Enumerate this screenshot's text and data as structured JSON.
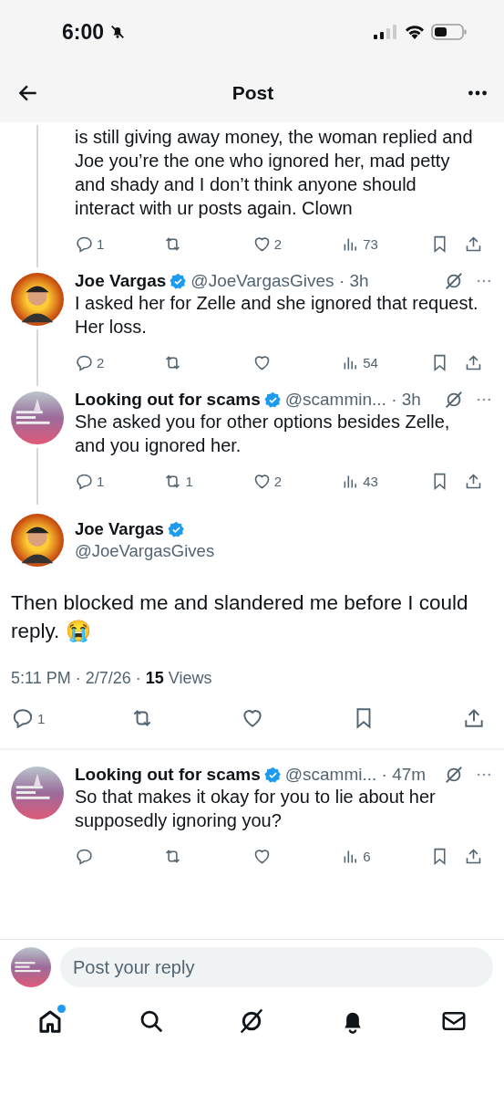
{
  "status_bar": {
    "time": "6:00",
    "silenced": true
  },
  "header": {
    "title": "Post"
  },
  "replies_above": [
    {
      "text": "is still giving away money, the woman replied and Joe you’re the one who ignored her, mad petty and shady and I don’t think anyone should interact with ur posts again. Clown",
      "stats": {
        "replies": "1",
        "likes": "2",
        "views": "73"
      },
      "connected": true
    },
    {
      "author": {
        "name": "Joe Vargas",
        "handle": "@JoeVargasGives",
        "verified": true
      },
      "time": "· 3h",
      "text": "I asked her for Zelle and she ignored that request. Her loss.",
      "stats": {
        "replies": "2",
        "views": "54"
      },
      "connected": true
    },
    {
      "author": {
        "name": "Looking out for scams",
        "handle": "@scammin...",
        "verified": true
      },
      "time": "· 3h",
      "text": "She asked you for other options besides Zelle, and you ignored her.",
      "stats": {
        "replies": "1",
        "reposts": "1",
        "likes": "2",
        "views": "43"
      },
      "connected": true
    }
  ],
  "main_post": {
    "author": {
      "name": "Joe Vargas",
      "handle": "@JoeVargasGives",
      "verified": true
    },
    "text": "Then blocked me and slandered me before I could reply. 😭",
    "timestamp": "5:11 PM · 2/7/26 ·",
    "views_count": "15",
    "views_label": "Views",
    "stats": {
      "replies": "1"
    }
  },
  "replies_below": [
    {
      "author": {
        "name": "Looking out for scams",
        "handle": "@scammi...",
        "verified": true
      },
      "time": "· 47m",
      "text": "So that makes it okay for you to lie about her supposedly ignoring you?",
      "stats": {
        "views": "6"
      },
      "connected": false
    }
  ],
  "composer": {
    "placeholder": "Post your reply"
  },
  "nav": [
    {
      "kind": "home",
      "badge": true
    },
    {
      "kind": "search",
      "badge": false
    },
    {
      "kind": "grok",
      "badge": false
    },
    {
      "kind": "notifications",
      "badge": false
    },
    {
      "kind": "messages",
      "badge": false
    }
  ]
}
